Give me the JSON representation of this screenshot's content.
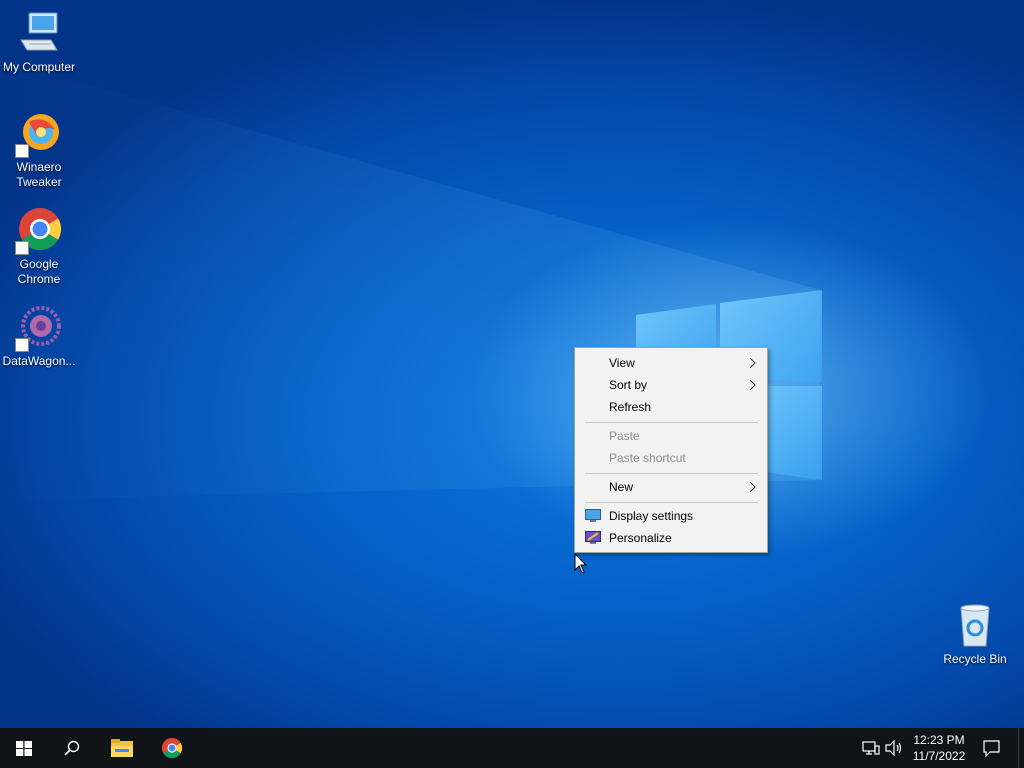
{
  "desktop": {
    "icons": [
      {
        "label": "My Computer",
        "icon": "computer-icon"
      },
      {
        "label": "Winaero\nTweaker",
        "icon": "winaero-tweaker-icon"
      },
      {
        "label": "Google\nChrome",
        "icon": "chrome-icon"
      },
      {
        "label": "DataWagon...",
        "icon": "datawagon-icon"
      },
      {
        "label": "Recycle Bin",
        "icon": "recycle-bin-icon"
      }
    ]
  },
  "context_menu": {
    "items": [
      {
        "label": "View",
        "submenu": true,
        "enabled": true
      },
      {
        "label": "Sort by",
        "submenu": true,
        "enabled": true
      },
      {
        "label": "Refresh",
        "submenu": false,
        "enabled": true
      },
      {
        "label": "Paste",
        "submenu": false,
        "enabled": false
      },
      {
        "label": "Paste shortcut",
        "submenu": false,
        "enabled": false
      },
      {
        "label": "New",
        "submenu": true,
        "enabled": true
      },
      {
        "label": "Display settings",
        "submenu": false,
        "enabled": true,
        "icon": "display-settings-icon"
      },
      {
        "label": "Personalize",
        "submenu": false,
        "enabled": true,
        "icon": "personalize-icon"
      }
    ]
  },
  "taskbar": {
    "pinned": [
      "start-icon",
      "search-icon",
      "file-explorer-icon",
      "chrome-icon"
    ],
    "tray_icons": [
      "network-icon",
      "volume-icon"
    ],
    "time": "12:23 PM",
    "date": "11/7/2022",
    "notifications_icon": "action-center-icon"
  },
  "colors": {
    "desktop_blue": "#0560c8",
    "taskbar": "#101418",
    "menu_bg": "#f2f2f2"
  }
}
